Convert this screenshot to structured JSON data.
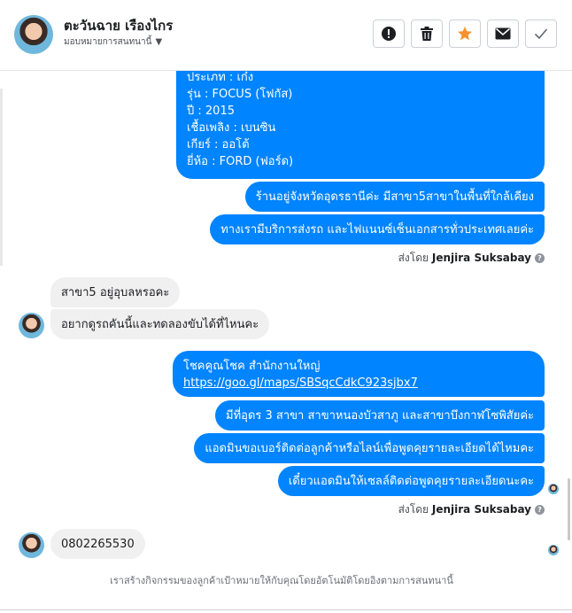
{
  "header": {
    "contact_name": "ตะวันฉาย เรืองไกร",
    "assign_label": "มอบหมายการสนทนานี้",
    "buttons": [
      {
        "name": "mark-spam",
        "icon": "exclamation-icon"
      },
      {
        "name": "delete",
        "icon": "trash-icon"
      },
      {
        "name": "star",
        "icon": "star-icon",
        "color": "#f5922f"
      },
      {
        "name": "mark-unread",
        "icon": "envelope-icon"
      },
      {
        "name": "mark-done",
        "icon": "checkmark-icon"
      }
    ]
  },
  "colors": {
    "outgoing": "#0084ff",
    "incoming": "#f1f0f0",
    "star": "#f5922f"
  },
  "messages": {
    "car_details": [
      "ประเภท : เก๋ง",
      "รุ่น : FOCUS (โฟกัส)",
      "ปี : 2015",
      "เชื้อเพลิง : เบนซิน",
      "เกียร์ : ออโต้",
      "ยี่ห้อ : FORD (ฟอร์ด)"
    ],
    "shop_location": "ร้านอยู่จังหวัดอุดรธานีค่ะ มีสาขา5สาขาในพื้นที่ใกล้เคียง",
    "services": "ทางเรามีบริการส่งรถ และไฟแนนซ์เซ็นเอกสารทั่วประเทศเลยค่ะ",
    "sent_by_1": {
      "prefix": "ส่งโดย",
      "name": "Jenjira Suksabay"
    },
    "branch5_question": "สาขา5 อยู่อุบลหรอคะ",
    "test_drive_question": "อยากดูรถคันนี้และทดลองขับได้ที่ไหนคะ",
    "hq_title": "โชคคูณโชค สำนักงานใหญ่",
    "hq_link": "https://goo.gl/maps/SBSqcCdkC923sjbx7",
    "udon_branches": "มีที่อุดร 3 สาขา สาขาหนองบัวสาภู และสาขาบึงกาฬโซพิสัยค่ะ",
    "ask_phone": "แอดมินขอเบอร์ติดต่อลูกค้าหรือไลน์เพื่อพูดคุยรายละเอียดได้ไหมคะ",
    "sales_contact": "เดี๋ยวแอดมินให้เซลล์ติดต่อพูดคุยรายละเอียดนะคะ",
    "sent_by_2": {
      "prefix": "ส่งโดย",
      "name": "Jenjira Suksabay"
    },
    "phone_number": "0802265530"
  },
  "footer_note": "เราสร้างกิจกรรมของลูกค้าเป้าหมายให้กับคุณโดยอัตโนมัติโดยอิงตามการสนทนานี้"
}
